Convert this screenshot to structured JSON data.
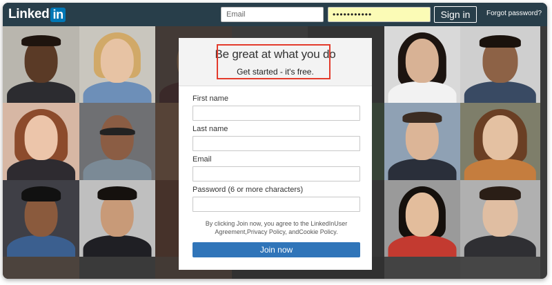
{
  "header": {
    "logo_text": "Linked",
    "logo_badge": "in",
    "email_placeholder": "Email",
    "password_mask": "•••••••••••",
    "signin_label": "Sign in",
    "forgot_label": "Forgot password?"
  },
  "signup": {
    "headline": "Be great at what you do",
    "subhead": "Get started - it's free.",
    "fields": [
      {
        "label": "First name"
      },
      {
        "label": "Last name"
      },
      {
        "label": "Email"
      },
      {
        "label": "Password (6 or more characters)"
      }
    ],
    "legal_line1": "By clicking Join now, you agree to the LinkedInUser",
    "legal_line2": "Agreement,Privacy Policy, andCookie Policy.",
    "join_label": "Join now"
  },
  "colors": {
    "topbar": "#283e4a",
    "logo_badge": "#0077b5",
    "join_button": "#3075b9",
    "highlight": "#e33a2b",
    "password_autofill": "#fbfbb6"
  }
}
